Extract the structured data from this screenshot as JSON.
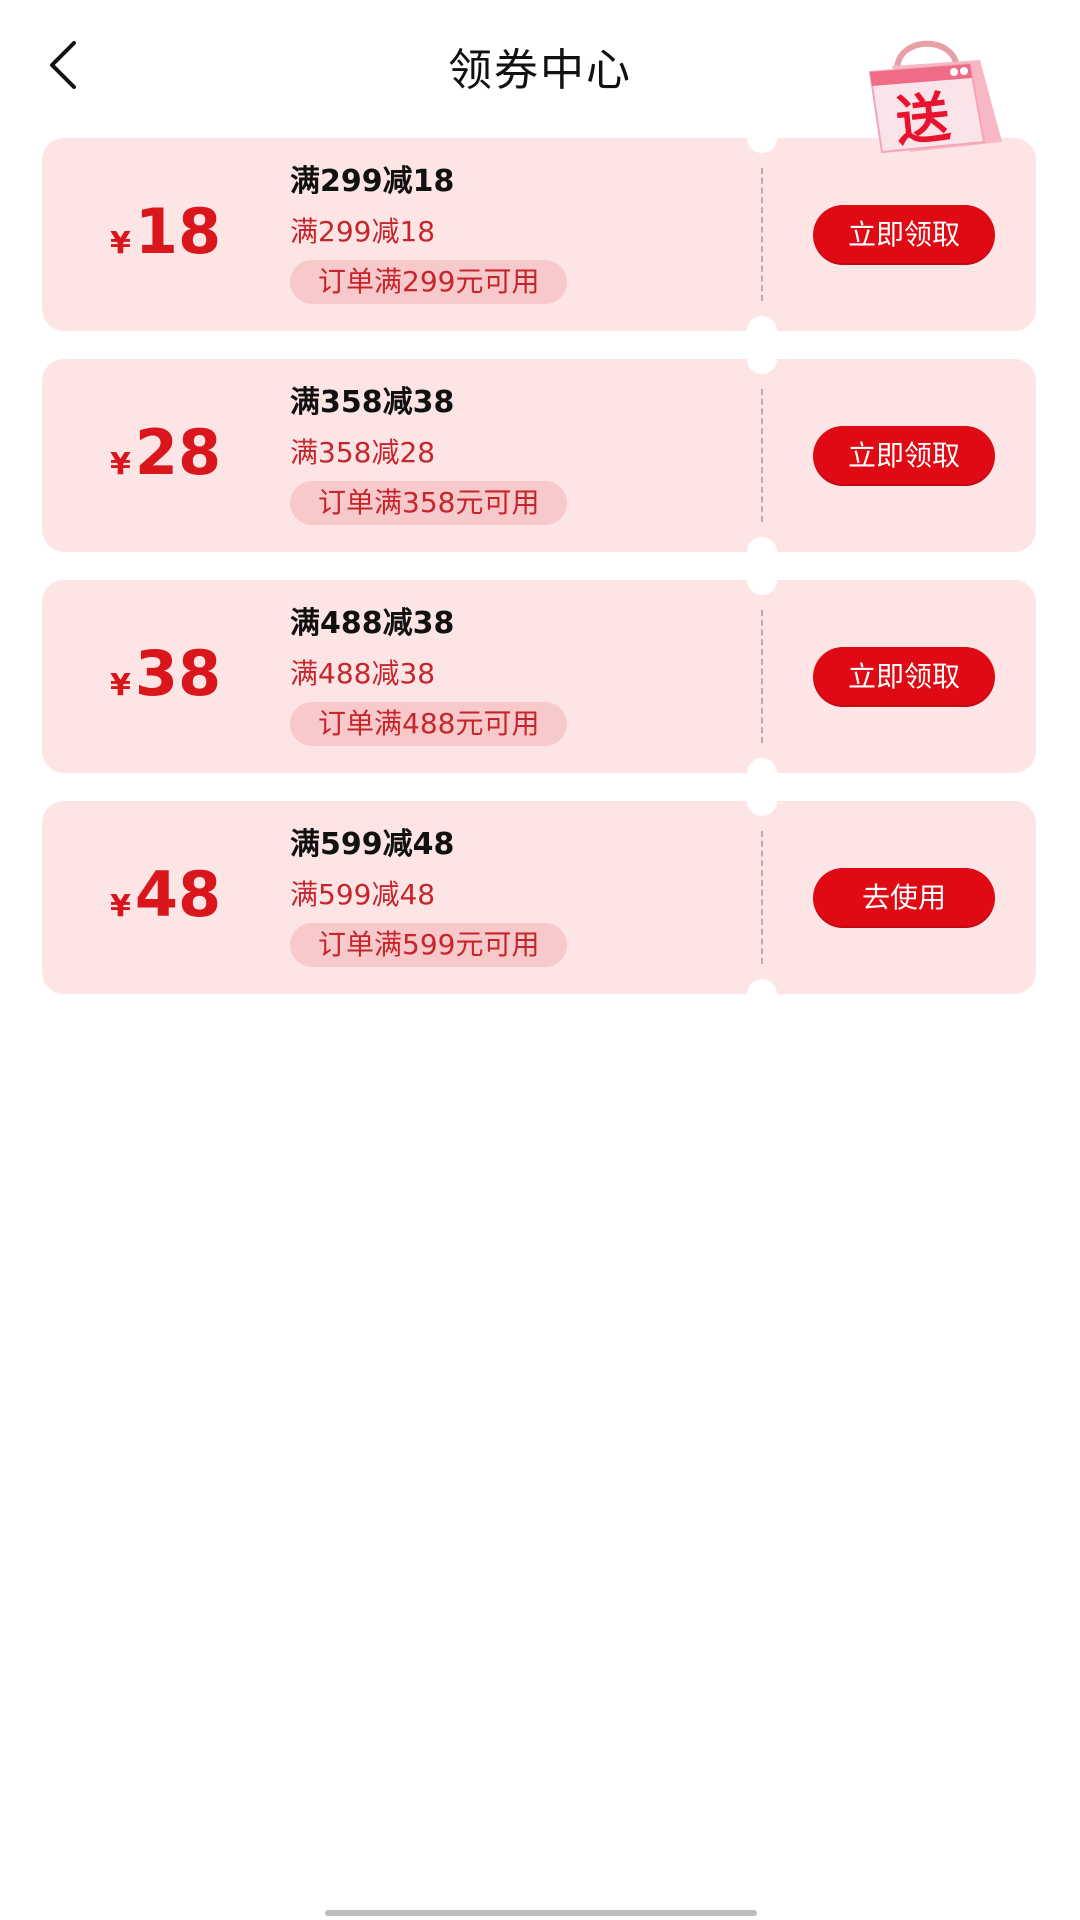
{
  "header": {
    "title": "领券中心",
    "back_icon": "chevron-left-icon",
    "badge_text": "送",
    "badge_icon": "gift-bag-icon"
  },
  "colors": {
    "accent": "#df0a14",
    "coupon_bg": "#fde5e6",
    "condition_bg": "#f8c9cb",
    "amount_text": "#d8161b"
  },
  "coupons": [
    {
      "currency": "¥",
      "amount": "18",
      "name": "满299减18",
      "subtitle": "满299减18",
      "condition": "订单满299元可用",
      "action": "立即领取"
    },
    {
      "currency": "¥",
      "amount": "28",
      "name": "满358减38",
      "subtitle": "满358减28",
      "condition": "订单满358元可用",
      "action": "立即领取"
    },
    {
      "currency": "¥",
      "amount": "38",
      "name": "满488减38",
      "subtitle": "满488减38",
      "condition": "订单满488元可用",
      "action": "立即领取"
    },
    {
      "currency": "¥",
      "amount": "48",
      "name": "满599减48",
      "subtitle": "满599减48",
      "condition": "订单满599元可用",
      "action": "去使用"
    }
  ]
}
